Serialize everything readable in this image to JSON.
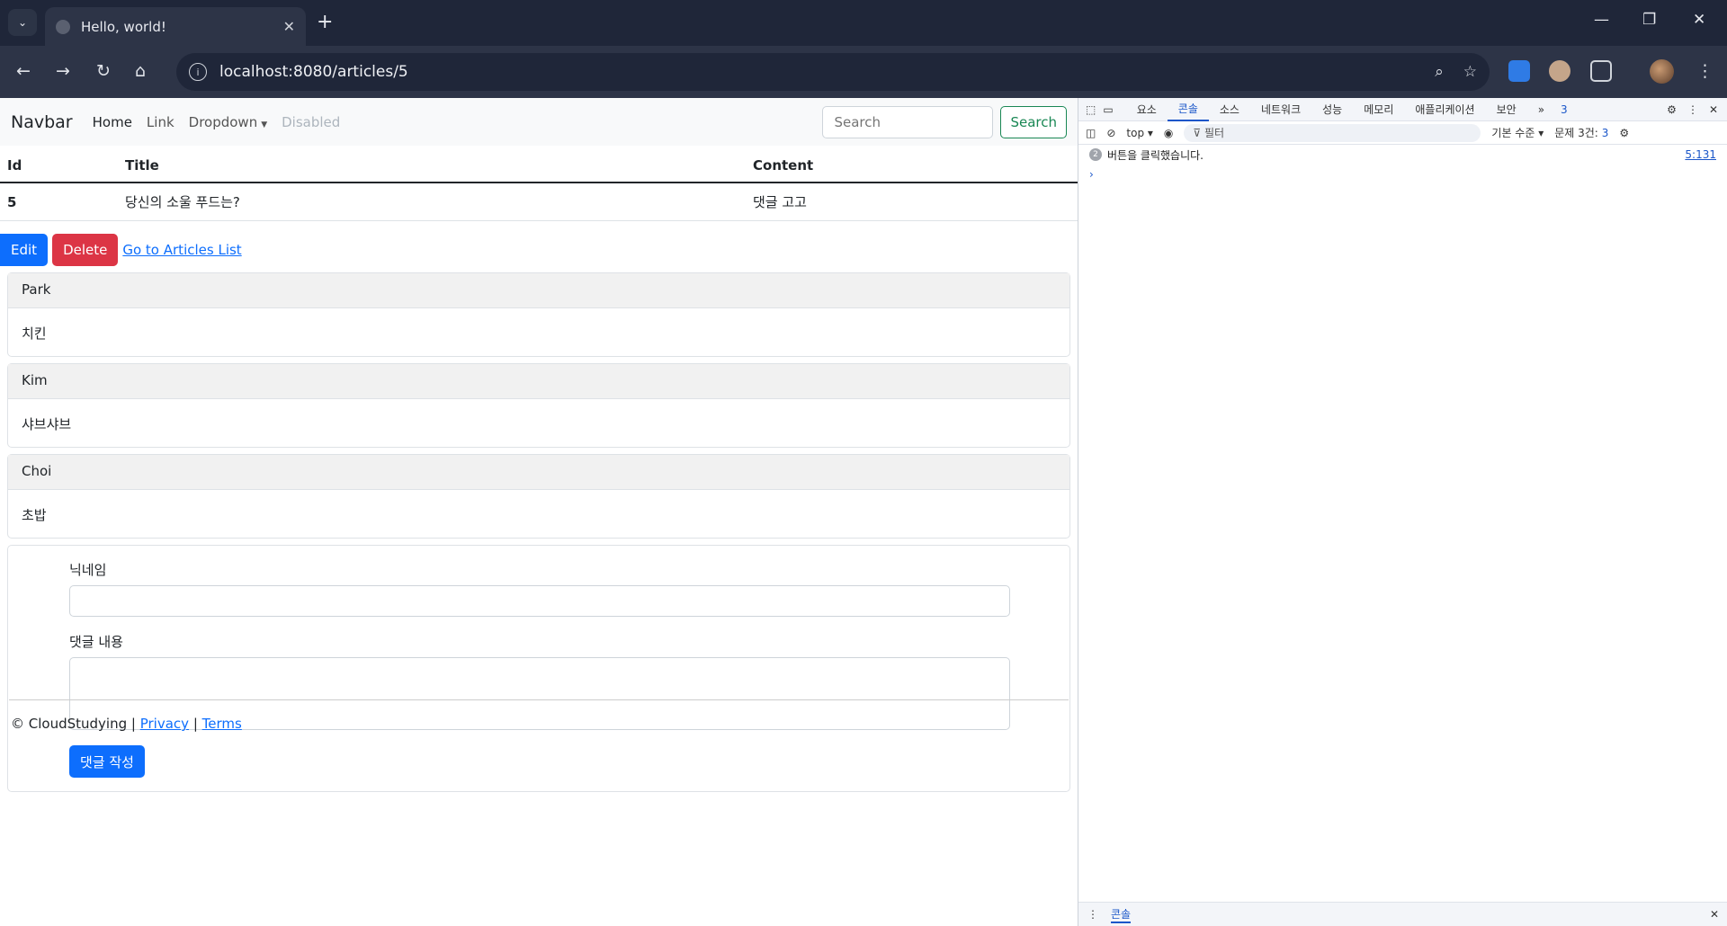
{
  "browser": {
    "tab_title": "Hello, world!",
    "url": "localhost:8080/articles/5"
  },
  "navbar": {
    "brand": "Navbar",
    "home": "Home",
    "link": "Link",
    "dropdown": "Dropdown",
    "disabled": "Disabled",
    "search_placeholder": "Search",
    "search_button": "Search"
  },
  "table": {
    "headers": [
      "Id",
      "Title",
      "Content"
    ],
    "row": [
      "5",
      "당신의 소울 푸드는?",
      "댓글 고고"
    ]
  },
  "actions": {
    "edit": "Edit",
    "delete": "Delete",
    "list_link": "Go to Articles List"
  },
  "comments": [
    {
      "nickname": "Park",
      "body": "치킨"
    },
    {
      "nickname": "Kim",
      "body": "샤브샤브"
    },
    {
      "nickname": "Choi",
      "body": "초밥"
    }
  ],
  "comment_form": {
    "nickname_label": "닉네임",
    "body_label": "댓글 내용",
    "submit": "댓글 작성"
  },
  "footer": {
    "copy": "© CloudStudying |",
    "privacy": "Privacy",
    "sep": "|",
    "terms": "Terms"
  },
  "devtools": {
    "tabs": [
      "요소",
      "콘솔",
      "소스",
      "네트워크",
      "성능",
      "메모리",
      "애플리케이션",
      "보안"
    ],
    "active_tab": "콘솔",
    "more": "»",
    "issues_count": "3",
    "context": "top",
    "filter_placeholder": "필터",
    "level": "기본 수준",
    "issues_text": "문제 3건:",
    "issues_badge": "3",
    "log_count": "2",
    "log_message": "버튼을 클릭했습니다.",
    "log_source": "5:131",
    "prompt": "›",
    "drawer_tab": "콘솔"
  }
}
